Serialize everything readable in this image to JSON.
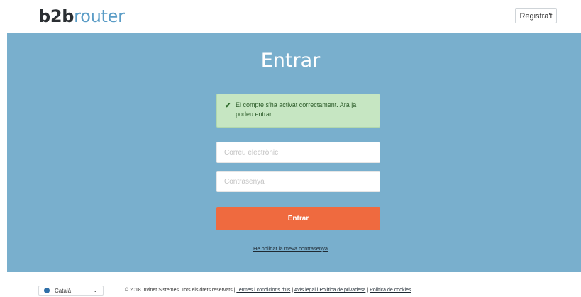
{
  "header": {
    "logo_bold": "b2b",
    "logo_light": "router",
    "register_label": "Registra't"
  },
  "login": {
    "title": "Entrar",
    "alert_message": "El compte s'ha activat correctament. Ara ja podeu entrar.",
    "email_placeholder": "Correu electrònic",
    "password_placeholder": "Contrasenya",
    "submit_label": "Entrar",
    "forgot_link": "He oblidat la meva contrasenya"
  },
  "footer": {
    "language": "Català",
    "copyright": "© 2018 Invinet Sistemes. Tots els drets reservats",
    "links": [
      "Termes i condicions d'ús",
      "Avís legal i Política de privadesa",
      "Política de cookies"
    ]
  },
  "icons": {
    "alert": "check-icon",
    "language": "globe-icon",
    "dropdown": "chevron-down-icon"
  },
  "colors": {
    "hero_background": "#79afcd",
    "submit_button": "#ef6a3f",
    "alert_background": "#c6e6c2",
    "logo_accent": "#5a9cc6"
  }
}
